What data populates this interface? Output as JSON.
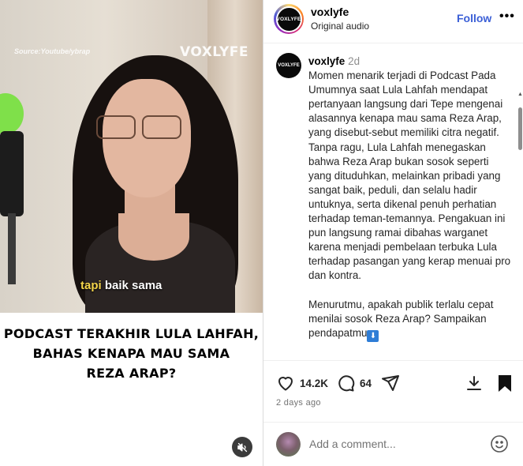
{
  "media": {
    "source_text": "Source:Youtube/ybrap",
    "watermark": "VOXLYFE",
    "caption_highlight": "tapi",
    "caption_rest": " baik sama",
    "headline_lines": [
      "PODCAST TERAKHIR LULA LAHFAH,",
      "BAHAS KENAPA MAU SAMA",
      "REZA ARAP?"
    ]
  },
  "header": {
    "avatar_text": "VOXLYFE",
    "username": "voxlyfe",
    "subtitle": "Original audio",
    "follow_label": "Follow",
    "more_label": "•••"
  },
  "post": {
    "avatar_text": "VOXLYFE",
    "username": "voxlyfe",
    "time": "2d",
    "caption_p1": "Momen menarik terjadi di Podcast Pada Umumnya saat Lula Lahfah mendapat pertanyaan langsung dari Tepe mengenai alasannya kenapa mau sama Reza Arap, yang disebut-sebut memiliki citra negatif. Tanpa ragu, Lula Lahfah menegaskan bahwa Reza Arap bukan sosok seperti yang dituduhkan, melainkan pribadi yang sangat baik, peduli, dan selalu hadir untuknya, serta dikenal penuh perhatian terhadap teman-temannya. Pengakuan ini pun langsung ramai dibahas warganet karena menjadi pembelaan terbuka Lula terhadap pasangan yang kerap menuai pro dan kontra.",
    "caption_p2": "Menurutmu, apakah publik terlalu cepat menilai sosok Reza Arap? Sampaikan pendapatmu",
    "emoji": "⬇"
  },
  "actions": {
    "likes": "14.2K",
    "comments": "64",
    "date": "2 days ago"
  },
  "comment_box": {
    "placeholder": "Add a comment..."
  },
  "colors": {
    "follow": "#3b5fd6",
    "muted_text": "#737373",
    "border": "#efefef"
  }
}
